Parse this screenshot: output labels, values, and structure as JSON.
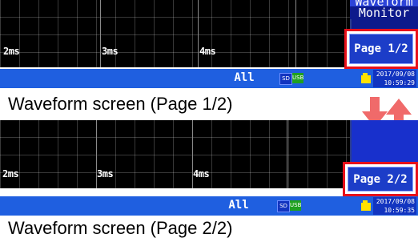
{
  "screens": [
    {
      "ticks": [
        "2ms",
        "3ms",
        "4ms"
      ],
      "right_title": "Monitor",
      "right_title_partial": "Waveform",
      "page_button": "Page 1/2",
      "status_all": "All",
      "sd_label": "SD",
      "usb_label": "USB",
      "date": "2017/09/08",
      "time": "10:59:29",
      "caption": "Waveform screen (Page 1/2)"
    },
    {
      "ticks": [
        "2ms",
        "3ms",
        "4ms"
      ],
      "page_button": "Page 2/2",
      "status_all": "All",
      "sd_label": "SD",
      "usb_label": "USB",
      "date": "2017/09/08",
      "time": "10:59:35",
      "caption": "Waveform screen (Page 2/2)"
    }
  ],
  "colors": {
    "page_highlight": "#e8101a",
    "arrow": "#f06a6a",
    "status_bar": "#1f5fe0",
    "button_blue": "#1c3dc8"
  },
  "icons": [
    "switch-pages-arrows-icon",
    "sd-card-icon",
    "usb-icon",
    "status-warning-icon"
  ]
}
